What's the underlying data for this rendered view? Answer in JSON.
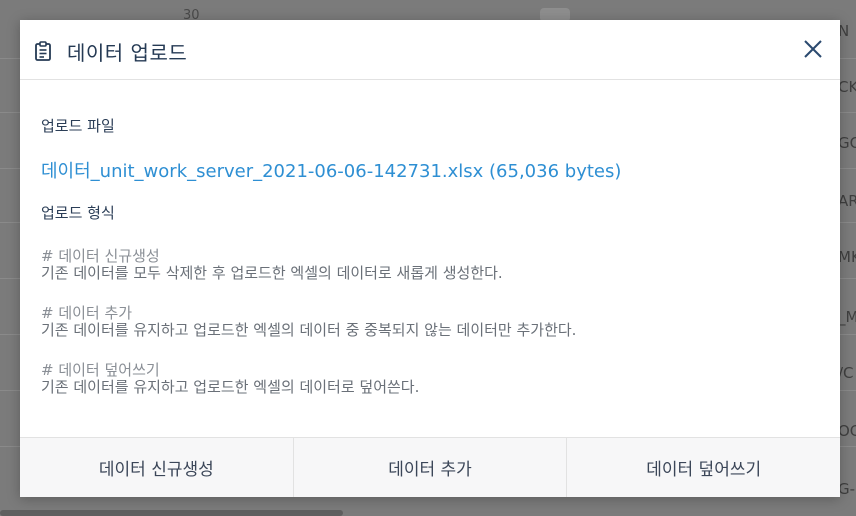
{
  "background": {
    "top_number": "30",
    "right_column": [
      "N",
      "CK",
      "GC",
      "AR",
      "MK",
      "_M",
      "/C",
      "OG",
      "G-S"
    ]
  },
  "modal": {
    "title": "데이터 업로드",
    "header_icon": "clipboard-icon",
    "close_icon": "close-icon",
    "file_section_label": "업로드 파일",
    "file_link": "데이터_unit_work_server_2021-06-06-142731.xlsx (65,036 bytes)",
    "format_section_label": "업로드 형식",
    "formats": [
      {
        "title": "# 데이터 신규생성",
        "description": "기존 데이터를 모두 삭제한 후 업로드한 엑셀의 데이터로 새롭게 생성한다."
      },
      {
        "title": "# 데이터 추가",
        "description": "기존 데이터를 유지하고 업로드한 엑셀의 데이터 중 중복되지 않는 데이터만 추가한다."
      },
      {
        "title": "# 데이터 덮어쓰기",
        "description": "기존 데이터를 유지하고 업로드한 엑셀의 데이터로 덮어쓴다."
      }
    ],
    "buttons": {
      "create": "데이터 신규생성",
      "add": "데이터 추가",
      "overwrite": "데이터 덮어쓰기"
    }
  },
  "colors": {
    "title": "#253a54",
    "link": "#2e8fd3",
    "overlay": "#7b7b7b"
  }
}
